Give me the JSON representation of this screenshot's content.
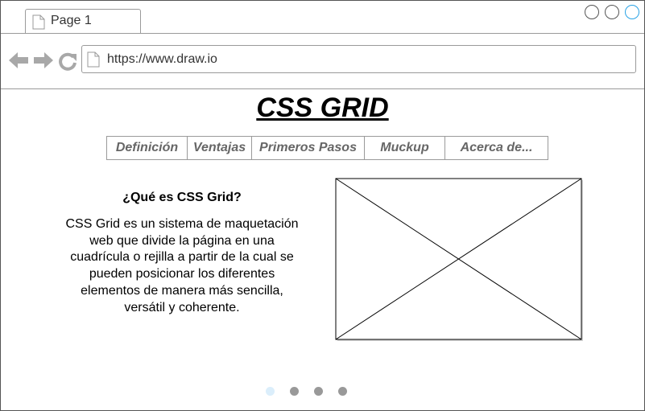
{
  "browser": {
    "tab_label": "Page 1",
    "url": "https://www.draw.io",
    "icons": [
      "page-icon",
      "back-arrow-icon",
      "forward-arrow-icon",
      "reload-icon"
    ],
    "window_button_accent": "#29a3e6"
  },
  "page": {
    "title": "CSS GRID",
    "menu": [
      {
        "label": "Definición"
      },
      {
        "label": "Ventajas"
      },
      {
        "label": "Primeros Pasos"
      },
      {
        "label": "Muckup"
      },
      {
        "label": "Acerca de..."
      }
    ],
    "section": {
      "heading": "¿Qué es CSS Grid?",
      "body": "CSS Grid es un sistema de maquetación web que divide la página en una cuadrícula o rejilla a partir de la cual se pueden posicionar los diferentes elementos de manera más sencilla, versátil y coherente."
    },
    "carousel": {
      "count": 4,
      "active_index": 0,
      "active_color": "#dbeefb",
      "inactive_color": "#999999"
    }
  }
}
